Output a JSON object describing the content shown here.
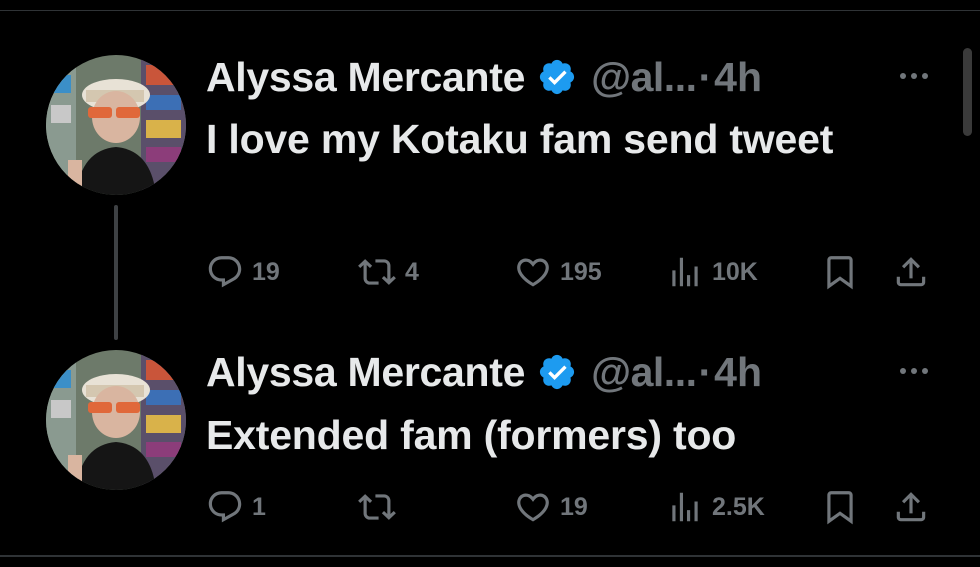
{
  "colors": {
    "background": "#000000",
    "text": "#e7e9ea",
    "secondary": "#71767b",
    "verified": "#1d9bf0",
    "divider": "#2f3336"
  },
  "tweets": [
    {
      "author_name": "Alyssa Mercante",
      "handle": "@al...",
      "separator": "·",
      "time": "4h",
      "text": "I love my Kotaku fam send tweet",
      "replies": "19",
      "reposts": "4",
      "likes": "195",
      "views": "10K",
      "icons": [
        "reply-icon",
        "repost-icon",
        "like-icon",
        "views-icon",
        "bookmark-icon",
        "share-icon",
        "more-icon",
        "verified-badge-icon"
      ]
    },
    {
      "author_name": "Alyssa Mercante",
      "handle": "@al...",
      "separator": "·",
      "time": "4h",
      "text": "Extended fam (formers) too",
      "replies": "1",
      "reposts": "",
      "likes": "19",
      "views": "2.5K",
      "icons": [
        "reply-icon",
        "repost-icon",
        "like-icon",
        "views-icon",
        "bookmark-icon",
        "share-icon",
        "more-icon",
        "verified-badge-icon"
      ]
    }
  ]
}
